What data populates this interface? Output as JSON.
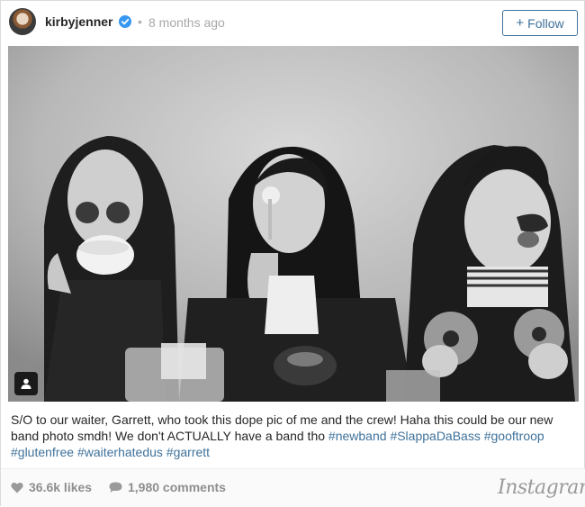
{
  "header": {
    "username": "kirbyjenner",
    "separator": "•",
    "timestamp": "8 months ago",
    "follow_plus": "+",
    "follow_label": "Follow"
  },
  "photo": {
    "style": "black-and-white",
    "tag_icon": "user-tag-icon"
  },
  "caption": {
    "text": "S/O to our waiter, Garrett, who took this dope pic of me and the crew! Haha this could be our new band photo smdh! We don't ACTUALLY have a band tho ",
    "hashtags": [
      "#newband",
      "#SlappaDaBass",
      "#gooftroop",
      "#glutenfree",
      "#waiterhatedus",
      "#garrett"
    ]
  },
  "footer": {
    "likes": "36.6k likes",
    "comments": "1,980 comments",
    "brand": "Instagram"
  },
  "colors": {
    "accent": "#3f729b",
    "verified": "#3897f0",
    "muted": "#8e8e8e"
  }
}
